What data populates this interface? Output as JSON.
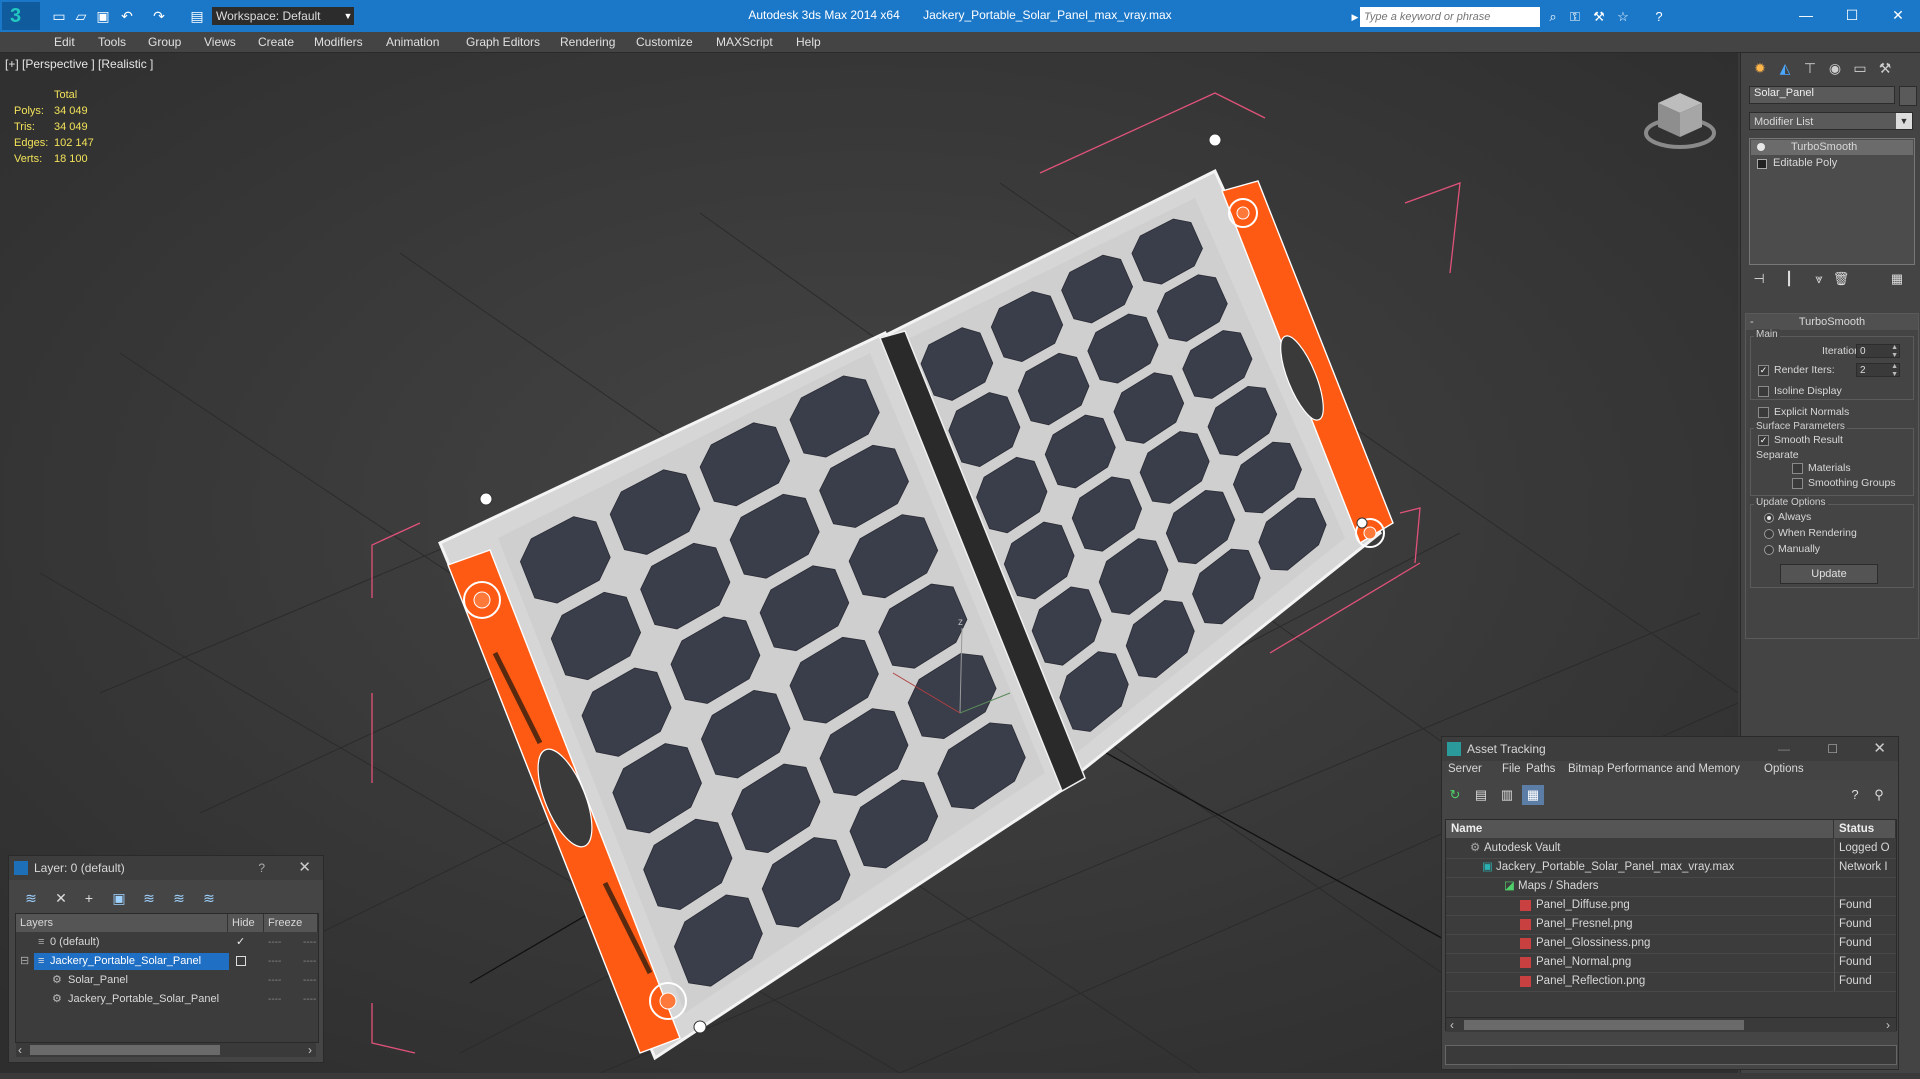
{
  "titlebar": {
    "app_name": "Autodesk 3ds Max  2014 x64",
    "file_name": "Jackery_Portable_Solar_Panel_max_vray.max",
    "workspace_label": "Workspace: Default",
    "search_placeholder": "Type a keyword or phrase"
  },
  "menubar": {
    "items": [
      "Edit",
      "Tools",
      "Group",
      "Views",
      "Create",
      "Modifiers",
      "Animation",
      "Graph Editors",
      "Rendering",
      "Customize",
      "MAXScript",
      "Help"
    ]
  },
  "viewport": {
    "label": "[+] [Perspective ] [Realistic ]",
    "stats": {
      "header": "Total",
      "rows": [
        {
          "key": "Polys:",
          "value": "34 049"
        },
        {
          "key": "Tris:",
          "value": "34 049"
        },
        {
          "key": "Edges:",
          "value": "102 147"
        },
        {
          "key": "Verts:",
          "value": "18 100"
        }
      ]
    },
    "axis_label": "z"
  },
  "command_panel": {
    "object_name": "Solar_Panel",
    "modifier_list_label": "Modifier List",
    "stack": [
      "TurboSmooth",
      "Editable Poly"
    ],
    "rollout": {
      "title": "TurboSmooth",
      "main_label": "Main",
      "iterations_label": "Iterations:",
      "iterations_value": "0",
      "render_iters_label": "Render Iters:",
      "render_iters_value": "2",
      "isoline_label": "Isoline Display",
      "explicit_normals_label": "Explicit Normals",
      "surface_params_label": "Surface Parameters",
      "smooth_result_label": "Smooth Result",
      "separate_label": "Separate",
      "materials_label": "Materials",
      "smoothing_groups_label": "Smoothing Groups",
      "update_options_label": "Update Options",
      "always_label": "Always",
      "when_rendering_label": "When Rendering",
      "manually_label": "Manually",
      "update_button": "Update"
    }
  },
  "layer_dialog": {
    "title": "Layer: 0 (default)",
    "help": "?",
    "columns": [
      "Layers",
      "Hide",
      "Freeze"
    ],
    "rows": [
      {
        "name": "0 (default)",
        "level": 1
      },
      {
        "name": "Jackery_Portable_Solar_Panel",
        "level": 1
      },
      {
        "name": "Solar_Panel",
        "level": 2
      },
      {
        "name": "Jackery_Portable_Solar_Panel",
        "level": 2
      }
    ]
  },
  "asset_dialog": {
    "title": "Asset Tracking",
    "menu": [
      "Server",
      "File",
      "Paths",
      "Bitmap Performance and Memory",
      "Options"
    ],
    "columns": [
      "Name",
      "Status"
    ],
    "rows": [
      {
        "name": "Autodesk Vault",
        "status": "Logged O"
      },
      {
        "name": "Jackery_Portable_Solar_Panel_max_vray.max",
        "status": "Network I"
      },
      {
        "name": "Maps / Shaders",
        "status": ""
      },
      {
        "name": "Panel_Diffuse.png",
        "status": "Found"
      },
      {
        "name": "Panel_Fresnel.png",
        "status": "Found"
      },
      {
        "name": "Panel_Glossiness.png",
        "status": "Found"
      },
      {
        "name": "Panel_Normal.png",
        "status": "Found"
      },
      {
        "name": "Panel_Reflection.png",
        "status": "Found"
      }
    ]
  },
  "colors": {
    "titlebar_bg": "#1b78c9",
    "viewport_bg": "#393939",
    "panel_frame": "#d4d4d4",
    "solar_cell": "#3a3d4a",
    "handle_orange": "#ff5a14",
    "bbox_pink": "#e0527a",
    "stats_yellow": "#f2e25a",
    "layer_selected": "#1f6fc5"
  }
}
